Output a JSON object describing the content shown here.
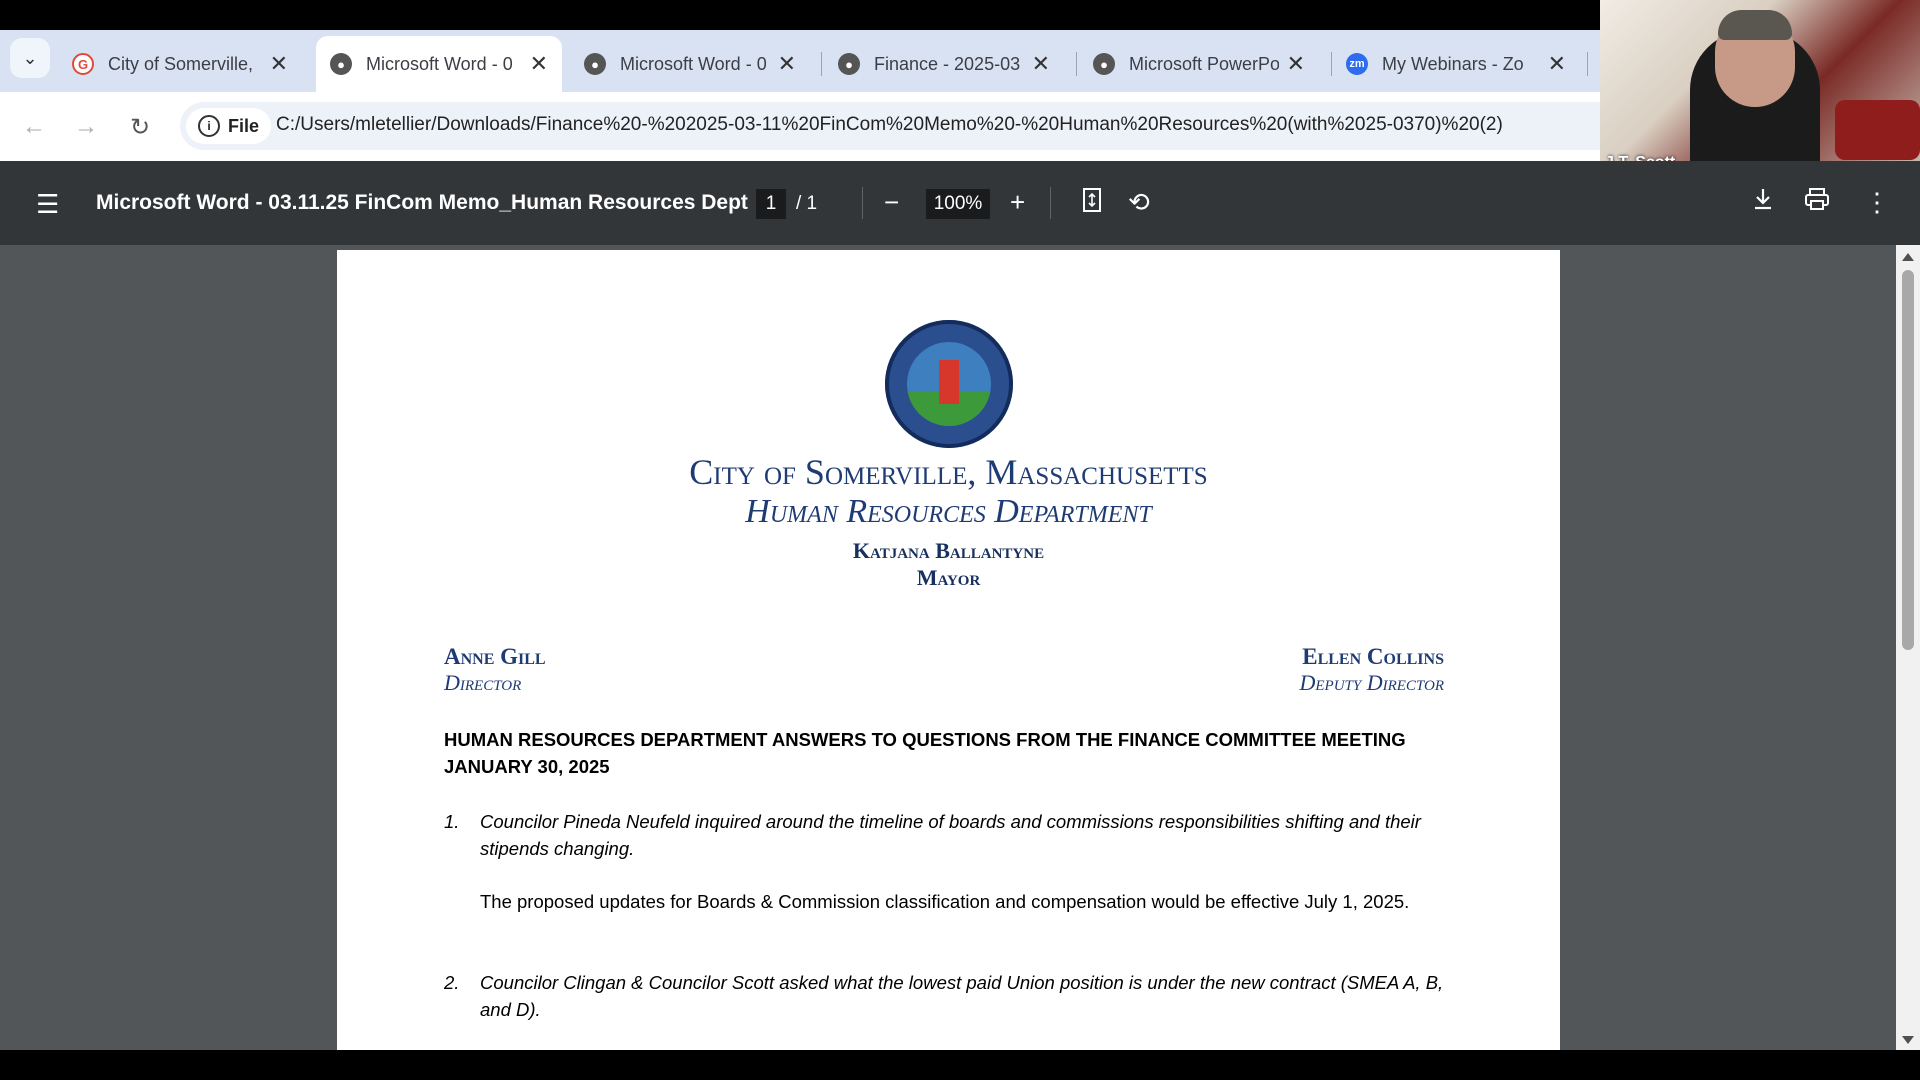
{
  "browser": {
    "tabs": [
      {
        "title": "City of Somerville,",
        "icon": "google-icon",
        "active": false
      },
      {
        "title": "Microsoft Word - 0",
        "icon": "globe-icon",
        "active": true
      },
      {
        "title": "Microsoft Word - 0",
        "icon": "globe-icon",
        "active": false
      },
      {
        "title": "Finance - 2025-03",
        "icon": "globe-icon",
        "active": false
      },
      {
        "title": "Microsoft PowerPo",
        "icon": "globe-icon",
        "active": false
      },
      {
        "title": "My Webinars - Zo",
        "icon": "zoom-icon",
        "active": false
      }
    ],
    "omnibox": {
      "chip_label": "File",
      "url": "C:/Users/mletellier/Downloads/Finance%20-%202025-03-11%20FinCom%20Memo%20-%20Human%20Resources%20(with%2025-0370)%20(2)"
    }
  },
  "webcam": {
    "name": "J.T. Scott"
  },
  "pdf_toolbar": {
    "title": "Microsoft Word - 03.11.25 FinCom Memo_Human Resources Dept",
    "page_current": "1",
    "page_total": "/ 1",
    "zoom": "100%"
  },
  "document": {
    "header": {
      "line1": "City of Somerville, Massachusetts",
      "line2": "Human Resources Department",
      "line3": "Katjana Ballantyne",
      "line4": "Mayor"
    },
    "left_staff": {
      "name": "Anne Gill",
      "title": "Director"
    },
    "right_staff": {
      "name": "Ellen Collins",
      "title": "Deputy Director"
    },
    "memo_heading": "HUMAN RESOURCES DEPARTMENT ANSWERS TO QUESTIONS FROM THE FINANCE COMMITTEE MEETING JANUARY 30, 2025",
    "questions": [
      {
        "number": "1.",
        "question": "Councilor Pineda Neufeld inquired around the timeline of boards and commissions responsibilities shifting and their stipends changing.",
        "answer": "The proposed updates for Boards & Commission classification and compensation would be effective July 1, 2025."
      },
      {
        "number": "2.",
        "question": "Councilor Clingan & Councilor Scott asked what the lowest paid Union position is under the new contract (SMEA A, B, and D).",
        "answer": ""
      }
    ]
  },
  "colors": {
    "heading_blue": "#1f3b74",
    "pdf_toolbar": "#323639",
    "viewer_bg": "#525659",
    "tabstrip": "#d9e2f3"
  }
}
